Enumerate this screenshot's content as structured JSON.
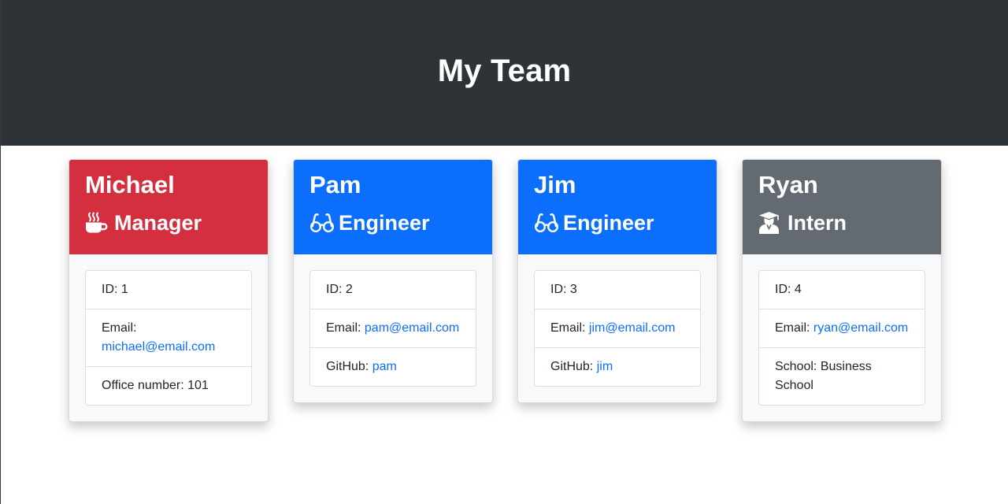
{
  "header": {
    "title": "My Team"
  },
  "employees": [
    {
      "name": "Michael",
      "role": "Manager",
      "role_icon": "coffee-icon",
      "header_color": "#d42f3e",
      "id_label": "ID: 1",
      "email_label": "Email:",
      "email": "michael@email.com",
      "extra_label": "Office number:",
      "extra_value": "101"
    },
    {
      "name": "Pam",
      "role": "Engineer",
      "role_icon": "glasses-icon",
      "header_color": "#0b6efd",
      "id_label": "ID: 2",
      "email_label": "Email:",
      "email": "pam@email.com",
      "extra_label": "GitHub:",
      "extra_value": "pam"
    },
    {
      "name": "Jim",
      "role": "Engineer",
      "role_icon": "glasses-icon",
      "header_color": "#0b6efd",
      "id_label": "ID: 3",
      "email_label": "Email:",
      "email": "jim@email.com",
      "extra_label": "GitHub:",
      "extra_value": "jim"
    },
    {
      "name": "Ryan",
      "role": "Intern",
      "role_icon": "graduate-icon",
      "header_color": "#636a72",
      "id_label": "ID: 4",
      "email_label": "Email:",
      "email": "ryan@email.com",
      "extra_label": "School:",
      "extra_value": "Business School"
    }
  ]
}
